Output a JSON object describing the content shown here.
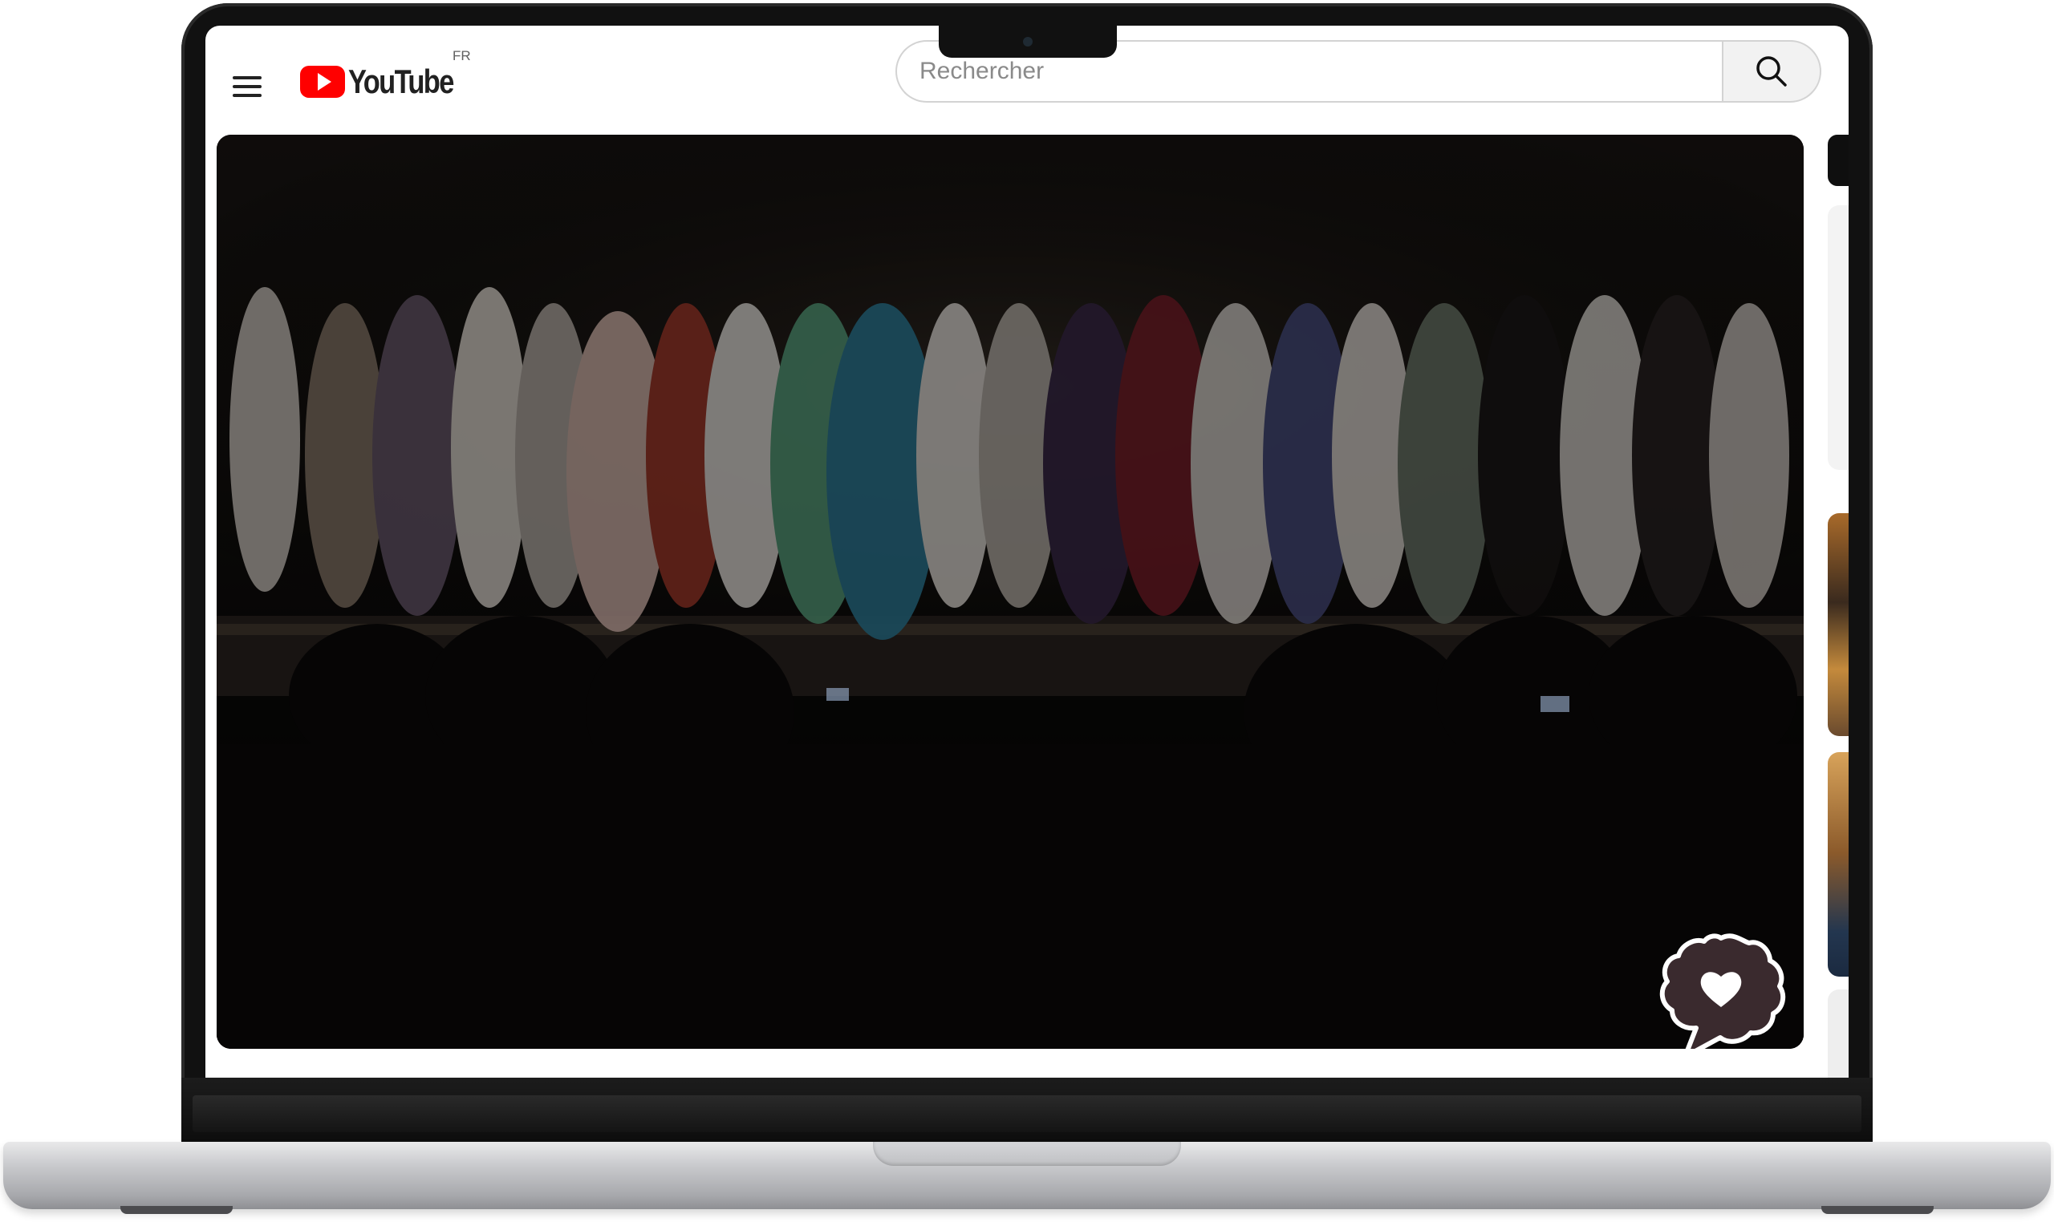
{
  "header": {
    "menu_icon": "hamburger-menu-icon",
    "logo_text": "YouTube",
    "logo_region": "FR",
    "search_placeholder": "Rechercher",
    "search_icon": "search-icon"
  },
  "player": {
    "overlay_icon": "heart-speech-bubble-icon"
  },
  "colors": {
    "brand_red": "#ff0000",
    "player_bg": "#050505",
    "search_border": "#d3d3d3"
  }
}
